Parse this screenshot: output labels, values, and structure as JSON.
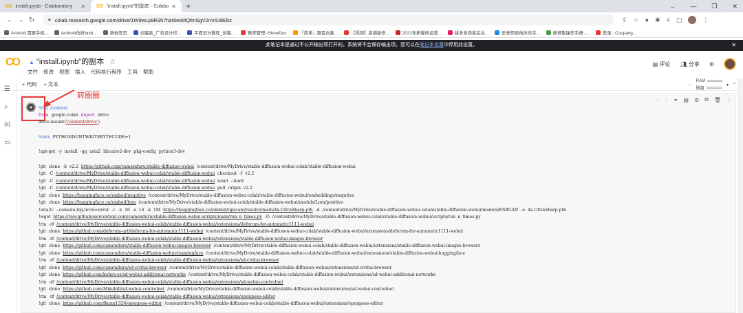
{
  "tabs": [
    {
      "title": "install.ipynb - Colaboratory",
      "active": false
    },
    {
      "title": "\"install.ipynb\"的副本 - Colabo",
      "active": true
    }
  ],
  "address": "colab.research.google.com/drive/1W9wLp9R3h7hzr8esMQfmSgV2nVdJ8Ebz",
  "bookmarks": [
    "Android 需要手机...",
    "Android仿好andr...",
    "新标签页",
    "创客贴_广告设计印...",
    "平面设计教程_创客...",
    "教师管理--ShowDoc",
    "「简单」题目合集...",
    "【视频】店铺装修...",
    "2021年新媒体运营...",
    "拼多多商家后台...",
    "史老师自他体培手...",
    "新预售操作手册 -...",
    "登录 - Coupang..."
  ],
  "banner": {
    "text": "此笔记本是通过不公开输出项打开的。系统将不会保存输出项。您可以在",
    "link": "笔记本设置",
    "tail": "中停用此设置。"
  },
  "header": {
    "title": "\"install.ipynb\"的副本",
    "menu": [
      "文件",
      "修改",
      "视图",
      "插入",
      "代码执行程序",
      "工具",
      "帮助"
    ],
    "comment": "评论",
    "share": "分享"
  },
  "toolbar": {
    "code": "+ 代码",
    "text": "+ 文本",
    "ram": "RAM",
    "disk": "磁盘"
  },
  "annotation": "转圈圈",
  "code": {
    "l1": "%cd  /content",
    "l2a": "from",
    "l2b": "  google.colab  ",
    "l2c": "import",
    "l2d": "  drive",
    "l3a": "drive.mount(",
    "l3b": "'/content/drive'",
    "l3c": ")",
    "l4a": "%env",
    "l4b": "  PYTHONDONTWRITEBYTECODE=1",
    "l5": "!apt-get  -y  install  -qq  aria2  libcairo2-dev  pkg-config  python3-dev",
    "l6a": "!git  clone  -b  v2.2  ",
    "l6b": "https://github.com/camenduru/stable-diffusion-webui",
    "l6c": "  /content/drive/MyDrive/stable-diffusion-webui-colab/stable-diffusion-webui",
    "l7a": "!git  -C  ",
    "l7b": "/content/drive/MyDrive/stable-diffusion-webui-colab/stable-diffusion-webui",
    "l7c": "  checkout  -f  v2.2",
    "l8a": "!git  -C  ",
    "l8b": "/content/drive/MyDrive/stable-diffusion-webui-colab/stable-diffusion-webui",
    "l8c": "  reset  --hard",
    "l9a": "!git  -C  ",
    "l9b": "/content/drive/MyDrive/stable-diffusion-webui-colab/stable-diffusion-webui",
    "l9c": "  pull  origin  v2.2",
    "l10a": "!git  clone  ",
    "l10b": "https://huggingface.co/embed/negative",
    "l10c": "  /content/drive/MyDrive/stable-diffusion-webui-colab/stable-diffusion-webui/embeddings/negative",
    "l11a": "!git  clone  ",
    "l11b": "https://huggingface.co/embed/lora",
    "l11c": "  /content/drive/MyDrive/stable-diffusion-webui-colab/stable-diffusion-webui/models/Lora/positive",
    "l12a": "!aria2c  --console-log-level=error  -c  -x  16  -s  16  -k  1M  ",
    "l12b": "https://huggingface.co/embed/upscale/resolve/main/4x-UltraSharp.pth",
    "l12c": "  -d  /content/drive/MyDrive/stable-diffusion-webui-colab/stable-diffusion-webui/models/ESRGAN  -o  4x-UltraSharp.pth",
    "l13a": "!wget  ",
    "l13b": "https://raw.githubusercontent.com/camenduru/stable-diffusion-webui-scripts/main/run_n_times.py",
    "l13c": "  -O  /content/drive/MyDrive/stable-diffusion-webui-colab/stable-diffusion-webui/scripts/run_n_times.py",
    "l14a": "!rm  -rf  ",
    "l14b": "/content/drive/MyDrive/stable-diffusion-webui-colab/stable-diffusion-webui/extensions/deforum-for-automatic1111-webui",
    "l15a": "!git  clone  ",
    "l15b": "https://github.com/deforum-art/deforum-for-automatic1111-webui",
    "l15c": "  /content/drive/MyDrive/stable-diffusion-webui-colab/stable-diffusion-webui/extensions/deforum-for-automatic1111-webui",
    "l16a": "!rm  -rf  ",
    "l16b": "/content/drive/MyDrive/stable-diffusion-webui-colab/stable-diffusion-webui/extensions/stable-diffusion-webui-images-browser",
    "l17a": "!git  clone  ",
    "l17b": "https://github.com/camenduru/stable-diffusion-webui-images-browser",
    "l17c": "  /content/drive/MyDrive/stable-diffusion-webui-colab/stable-diffusion-webui/extensions/stable-diffusion-webui-images-browser",
    "l18a": "!git  clone  ",
    "l18b": "https://github.com/camenduru/stable-diffusion-webui-huggingface",
    "l18c": "  /content/drive/MyDrive/stable-diffusion-webui-colab/stable-diffusion-webui/extensions/stable-diffusion-webui-huggingface",
    "l19a": "!rm  -rf  ",
    "l19b": "/content/drive/MyDrive/stable-diffusion-webui-colab/stable-diffusion-webui/extensions/sd-civitai-browser",
    "l20a": "!git  clone  ",
    "l20b": "https://github.com/camenduru/sd-civitai-browser",
    "l20c": "  /content/drive/MyDrive/stable-diffusion-webui-colab/stable-diffusion-webui/extensions/sd-civitai-browser",
    "l21a": "!git  clone  ",
    "l21b": "https://github.com/kohya-ss/sd-webui-additional-networks",
    "l21c": "  /content/drive/MyDrive/stable-diffusion-webui-colab/stable-diffusion-webui/extensions/sd-webui-additional-networks",
    "l22a": "!rm  -rf  ",
    "l22b": "/content/drive/MyDrive/stable-diffusion-webui-colab/stable-diffusion-webui/extensions/sd-webui-controlnet",
    "l23a": "!git  clone  ",
    "l23b": "https://github.com/Mikubill/sd-webui-controlnet",
    "l23c": "  /content/drive/MyDrive/stable-diffusion-webui-colab/stable-diffusion-webui/extensions/sd-webui-controlnet",
    "l24a": "!rm  -rf  ",
    "l24b": "/content/drive/MyDrive/stable-diffusion-webui-colab/stable-diffusion-webui/extensions/openpose-editor",
    "l25a": "!git  clone  ",
    "l25b": "https://github.com/fkunn1326/openpose-editor",
    "l25c": "  /content/drive/MyDrive/stable-diffusion-webui-colab/stable-diffusion-webui/extensions/openpose-editor"
  }
}
